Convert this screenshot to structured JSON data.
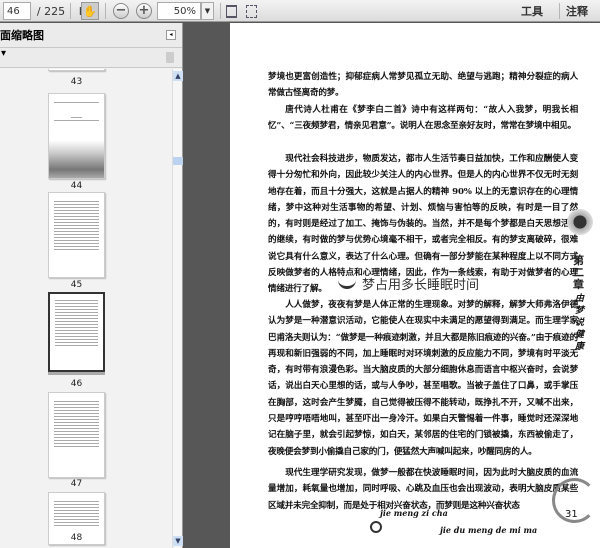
{
  "toolbar": {
    "page_current": "46",
    "page_total": "/ 225",
    "zoom": "50%",
    "tools": "工具",
    "notes": "注释"
  },
  "sidebar": {
    "title": "面缩略图",
    "options": "▾",
    "thumbnails": [
      {
        "label": "43"
      },
      {
        "label": "44"
      },
      {
        "label": "45"
      },
      {
        "label": "46",
        "selected": true
      },
      {
        "label": "47"
      },
      {
        "label": "48"
      }
    ]
  },
  "page": {
    "paragraphs": [
      "梦境也更富创造性；抑郁症病人常梦见孤立无助、绝望与逃跑；精神分裂症的病人常做古怪离奇的梦。",
      "唐代诗人杜甫在《梦李白二首》诗中有这样两句：“故人入我梦，明我长相忆”、“三夜频梦君，情亲见君意”。说明人在思念至亲好友时，常常在梦境中相见。",
      "现代社会科技进步，物质发达，都市人生活节奏日益加快，工作和应酬使人变得十分匆忙和外向，因此较少关注人的内心世界。但是人的内心世界不仅无时无刻地存在着，而且十分强大，这就是占据人的精神 90% 以上的无意识存在的心理情绪，梦中这种对生活事物的希望、计划、烦恼与害怕等的反映，有时是一目了然的，有时则是经过了加工、掩饰与伪装的。当然，并不是每个梦都是白天思想活动的继续，有时做的梦与优势心境毫不相干，或者完全相反。有的梦支离破碎，很难说它具有什么意义，表达了什么心理。但确有一部分梦能在某种程度上以不同方式反映做梦者的人格特点和心理情绪，因此，作为一条线索，有助于对做梦者的心理情绪进行了解。",
      "人人做梦，夜夜有梦是人体正常的生理现象。对梦的解释，解梦大师弗洛伊德认为梦是一种潜意识活动，它能使人在现实中未满足的愿望得到满足。而生理学家巴甫洛夫则认为：“做梦是一种痕迹刺激，并且大都是陈旧痕迹的兴奋。”由于痕迹的再现和新旧强弱的不同，加上睡眠时对环境刺激的反应能力不同，梦境有时平淡无奇，有时带有浪漫色彩。当大脑皮质的大部分细胞休息而语言中枢兴奋时，会说梦话，说出白天心里想的话，或与人争吵，甚至唱歌。当被子盖住了口鼻，或手掌压在胸部，这时会产生梦魇，自己觉得被压得不能转动，既挣扎不开，又喊不出来，只是哼哼唔唔地叫，甚至吓出一身冷汗。如果白天警惕着一件事，睡觉时还深深地记在脑子里，就会引起梦惊，如白天，某邻居的住宅的门锁被撬，东西被偷走了，夜晚便会梦到小偷撬自己家的门，便猛然大声喊叫起来，吵醒同房的人。",
      "现代生理学研究发现，做梦一般都在快波睡眠时间，因为此时大脑皮质的血流量增加，耗氧量也增加，同时呼吸、心跳及血压也会出现波动，表明大脑皮质某些区域并未完全抑制，而是处于相对兴奋状态，而梦则是这种兴奋状态"
    ],
    "section_heading": "梦占用多长睡眠时间",
    "chapter": "第二章",
    "side_title": "由梦说健康",
    "page_number": "31",
    "pinyin_1": "jie meng zi cha",
    "pinyin_2": "jie du meng de mi ma"
  }
}
